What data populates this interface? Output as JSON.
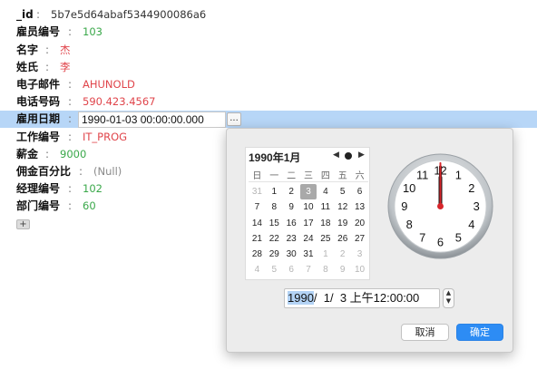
{
  "fields": [
    {
      "key": "_id",
      "value": "5b7e5d64abaf5344900086a6",
      "kind": "id"
    },
    {
      "key": "雇员编号",
      "value": "103",
      "kind": "num"
    },
    {
      "key": "名字",
      "value": "杰",
      "kind": "str"
    },
    {
      "key": "姓氏",
      "value": "李",
      "kind": "str"
    },
    {
      "key": "电子邮件",
      "value": "AHUNOLD",
      "kind": "str"
    },
    {
      "key": "电话号码",
      "value": "590.423.4567",
      "kind": "str"
    },
    {
      "key": "雇用日期",
      "value": "1990-01-03 00:00:00.000",
      "kind": "date"
    },
    {
      "key": "工作编号",
      "value": "IT_PROG",
      "kind": "str"
    },
    {
      "key": "薪金",
      "value": "9000",
      "kind": "num"
    },
    {
      "key": "佣金百分比",
      "value": "(Null)",
      "kind": "null"
    },
    {
      "key": "经理编号",
      "value": "102",
      "kind": "num"
    },
    {
      "key": "部门编号",
      "value": "60",
      "kind": "num"
    }
  ],
  "separator": ":",
  "ellipsis_label": "...",
  "add_label": "+",
  "calendar": {
    "title": "1990年1月",
    "prev_glyph": "◀",
    "next_glyph": "▶",
    "weekdays": [
      "日",
      "一",
      "二",
      "三",
      "四",
      "五",
      "六"
    ],
    "days": [
      "31",
      "1",
      "2",
      "3",
      "4",
      "5",
      "6",
      "7",
      "8",
      "9",
      "10",
      "11",
      "12",
      "13",
      "14",
      "15",
      "16",
      "17",
      "18",
      "19",
      "20",
      "21",
      "22",
      "23",
      "24",
      "25",
      "26",
      "27",
      "28",
      "29",
      "30",
      "31",
      "1",
      "2",
      "3",
      "4",
      "5",
      "6",
      "7",
      "8",
      "9",
      "10"
    ],
    "muted_days": [
      0,
      32,
      33,
      34,
      35,
      36,
      37,
      38,
      39,
      40,
      41
    ],
    "selected_index": 3
  },
  "clock": {
    "numerals": [
      "12",
      "1",
      "2",
      "3",
      "4",
      "5",
      "6",
      "7",
      "8",
      "9",
      "10",
      "11"
    ],
    "hour": 12,
    "minute": 0,
    "second": 0,
    "hand_color": "#d7262b"
  },
  "datetime_field": {
    "year": "1990",
    "rest": "/  1/  3 上午12:00:00"
  },
  "buttons": {
    "cancel": "取消",
    "ok": "确定"
  },
  "colors": {
    "string": "#e0454b",
    "number": "#3aa84a",
    "selection": "#b7d6f7",
    "accent": "#2d8cf4"
  }
}
